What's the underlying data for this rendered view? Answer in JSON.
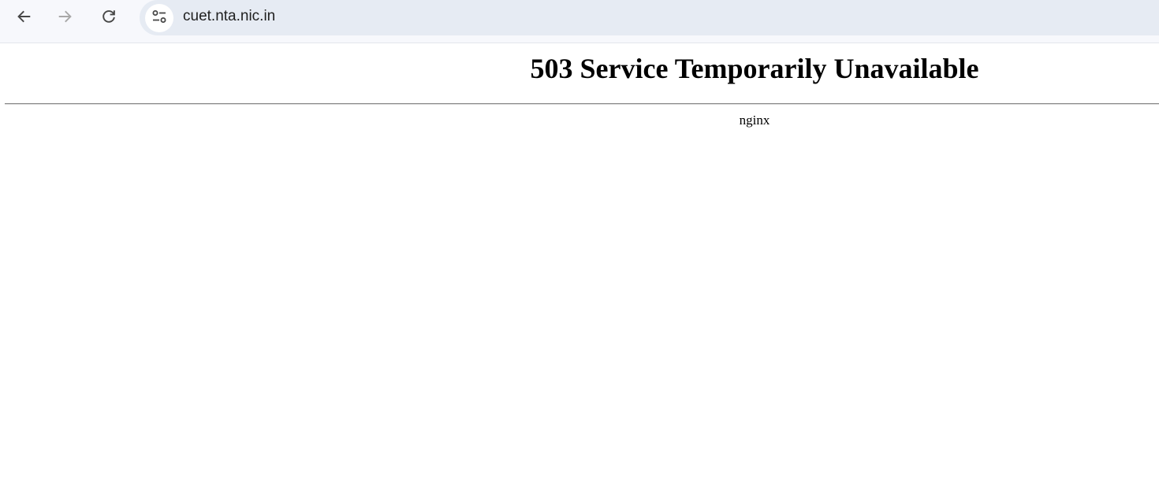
{
  "browser": {
    "url": "cuet.nta.nic.in",
    "icons": {
      "back": "arrow-left-icon",
      "forward": "arrow-right-icon",
      "reload": "reload-icon",
      "site_info": "tune-icon"
    },
    "colors": {
      "toolbar_bg": "#f7f8fc",
      "omnibox_bg": "#e6ebf3",
      "icon_active": "#474747",
      "icon_disabled": "#a8a8a8"
    }
  },
  "page": {
    "title": "503 Service Temporarily Unavailable",
    "server": "nginx"
  }
}
